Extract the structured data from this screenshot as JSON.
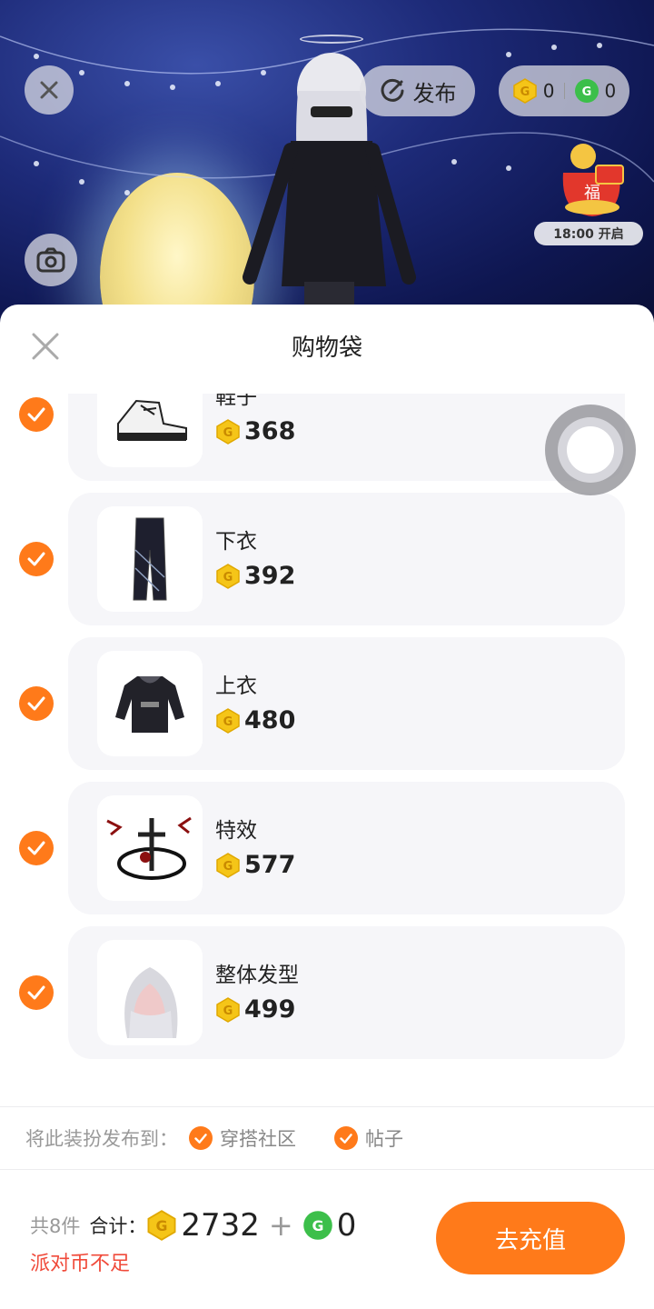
{
  "top_bar": {
    "publish_label": "发布",
    "gold_balance": "0",
    "green_balance": "0",
    "event_time": "18:00 开启"
  },
  "sheet": {
    "title": "购物袋",
    "items": [
      {
        "name": "鞋子",
        "price": "368",
        "icon": "shoes-thumbnail"
      },
      {
        "name": "下衣",
        "price": "392",
        "icon": "pants-thumbnail"
      },
      {
        "name": "上衣",
        "price": "480",
        "icon": "hoodie-thumbnail"
      },
      {
        "name": "特效",
        "price": "577",
        "icon": "effect-thumbnail"
      },
      {
        "name": "整体发型",
        "price": "499",
        "icon": "hairstyle-thumbnail"
      }
    ],
    "publish_to_label": "将此装扮发布到：",
    "publish_options": [
      "穿搭社区",
      "帖子"
    ]
  },
  "footer": {
    "count_label": "共8件",
    "total_label": "合计：",
    "gold_total": "2732",
    "plus": "+",
    "green_total": "0",
    "warning": "派对币不足",
    "recharge_label": "去充值"
  },
  "colors": {
    "accent": "#ff7a1a",
    "warning": "#f04a3a",
    "gold_coin": "#f5c518",
    "green_coin": "#3cbf4a"
  }
}
